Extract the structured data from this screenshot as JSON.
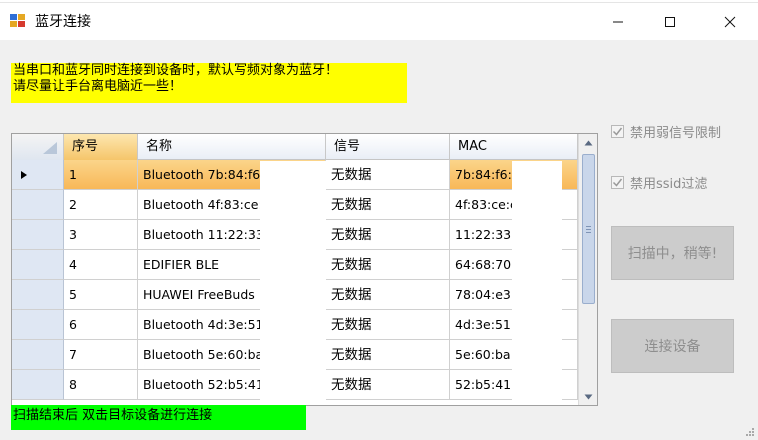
{
  "window": {
    "title": "蓝牙连接",
    "icon": "app-windows-form-icon",
    "controls": [
      "minimize-icon",
      "maximize-icon",
      "close-icon"
    ]
  },
  "notice": {
    "line1": "当串口和蓝牙同时连接到设备时，默认写频对象为蓝牙！",
    "line2": "请尽量让手台离电脑近一些！",
    "background": "#ffff00"
  },
  "grid": {
    "columns": [
      "序号",
      "名称",
      "信号",
      "MAC"
    ],
    "rows": [
      {
        "seq": "1",
        "name": "Bluetooth 7b:84:f6:5",
        "signal": "无数据",
        "mac": "7b:84:f6:5",
        "selected": true
      },
      {
        "seq": "2",
        "name": "Bluetooth 4f:83:ce:c",
        "signal": "无数据",
        "mac": "4f:83:ce:c"
      },
      {
        "seq": "3",
        "name": "Bluetooth 11:22:33:",
        "signal": "无数据",
        "mac": "11:22:33:"
      },
      {
        "seq": "4",
        "name": "EDIFIER BLE",
        "signal": "无数据",
        "mac": "64:68:70:"
      },
      {
        "seq": "5",
        "name": "HUAWEI FreeBuds",
        "signal": "无数据",
        "mac": "78:04:e3:"
      },
      {
        "seq": "6",
        "name": "Bluetooth 4d:3e:51:",
        "signal": "无数据",
        "mac": "4d:3e:51:"
      },
      {
        "seq": "7",
        "name": "Bluetooth 5e:60:ba:",
        "signal": "无数据",
        "mac": "5e:60:ba:"
      },
      {
        "seq": "8",
        "name": "Bluetooth 52:b5:41:",
        "signal": "无数据",
        "mac": "52:b5:41:"
      }
    ],
    "selected_row_color": "#f8b858"
  },
  "options": {
    "disable_weak_signal": "禁用弱信号限制",
    "disable_ssid_filter": "禁用ssid过滤"
  },
  "buttons": {
    "scan": "扫描中，稍等!",
    "connect": "连接设备"
  },
  "status": {
    "text": "扫描结束后 双击目标设备进行连接",
    "background": "#00ff00"
  }
}
